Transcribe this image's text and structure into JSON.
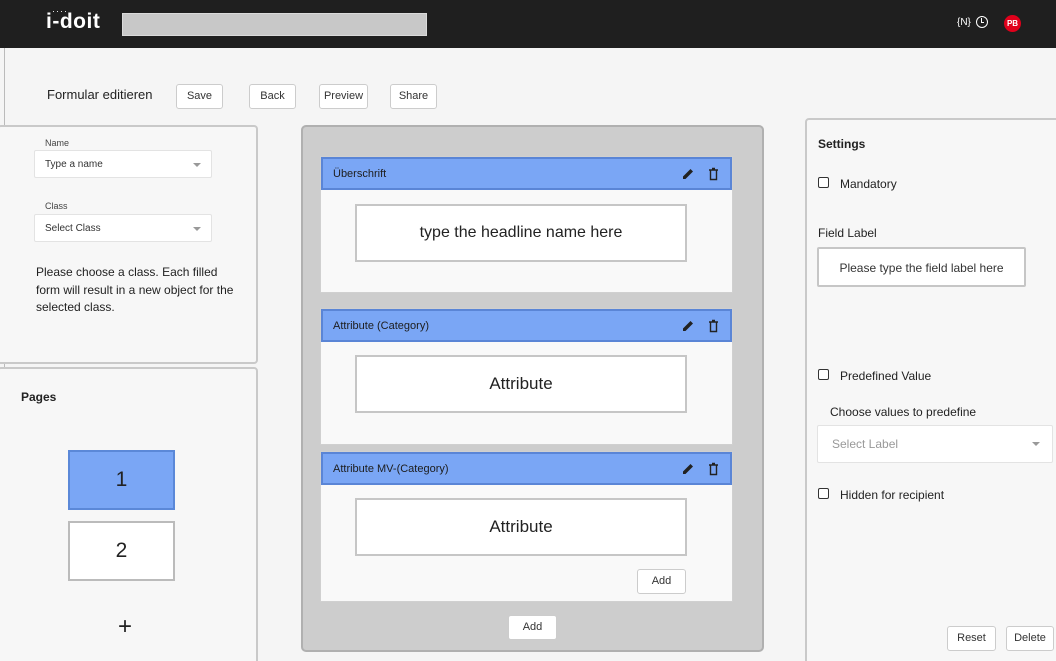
{
  "app": {
    "logo": "i-doit",
    "search_value": "",
    "top_n": "{N}",
    "avatar_initials": "PB",
    "avatar_color": "#e0001b"
  },
  "toolbar": {
    "title": "Formular editieren",
    "save": "Save",
    "back": "Back",
    "preview": "Preview",
    "share": "Share"
  },
  "form_settings": {
    "name_label": "Name",
    "name_value": "Type a name",
    "class_label": "Class",
    "class_value": "Select Class",
    "help_text": "Please choose a class. Each filled  form will result in a new object for the selected class."
  },
  "pages": {
    "title": "Pages",
    "items": [
      "1",
      "2"
    ],
    "active": "1",
    "add": "+"
  },
  "blocks": [
    {
      "title": "Überschrift",
      "field": "type the headline name here"
    },
    {
      "title": "Attribute (Category)",
      "field": "Attribute"
    },
    {
      "title": "Attribute MV-(Category)",
      "field": "Attribute",
      "add": "Add"
    }
  ],
  "canvas": {
    "add": "Add"
  },
  "settings": {
    "title": "Settings",
    "mandatory": "Mandatory",
    "field_label_title": "Field Label",
    "field_label_placeholder": "Please type the field label here",
    "predefined": "Predefined Value",
    "choose_values": "Choose values to predefine",
    "select_label": "Select Label",
    "hidden": "Hidden for recipient",
    "reset": "Reset",
    "delete": "Delete"
  },
  "colors": {
    "accent_block": "#7aa6f5",
    "accent_border": "#5a85d6",
    "topbar": "#1f1f1f"
  }
}
